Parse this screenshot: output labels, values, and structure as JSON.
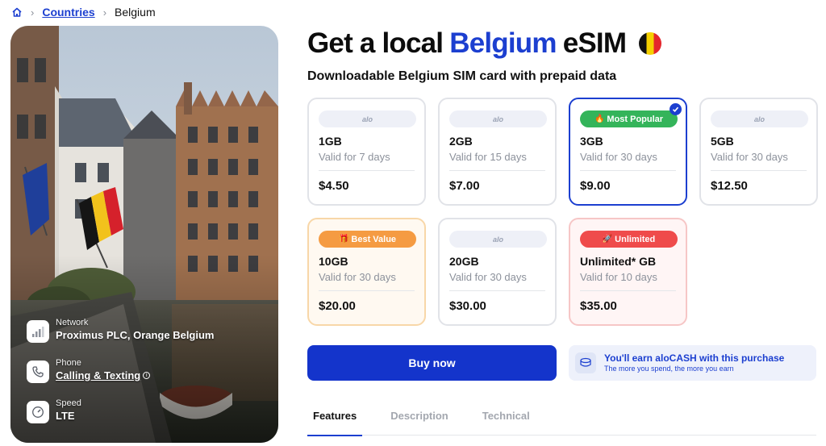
{
  "breadcrumb": {
    "home_icon": "home-icon",
    "link": "Countries",
    "current": "Belgium"
  },
  "hero": {
    "info": [
      {
        "icon": "signal-icon",
        "label": "Network",
        "value": "Proximus PLC, Orange Belgium"
      },
      {
        "icon": "phone-icon",
        "label": "Phone",
        "value": "Calling & Texting"
      },
      {
        "icon": "speedometer-icon",
        "label": "Speed",
        "value": "LTE"
      }
    ]
  },
  "title": {
    "prefix": "Get a local",
    "country": "Belgium",
    "suffix": "eSIM",
    "flag_colors": [
      "#111111",
      "#f5d000",
      "#e4262c"
    ]
  },
  "subtitle": "Downloadable Belgium SIM card with prepaid data",
  "plans": [
    {
      "badge": "alo",
      "badge_type": "brand",
      "data": "1GB",
      "validity": "Valid for 7 days",
      "price": "$4.50"
    },
    {
      "badge": "alo",
      "badge_type": "brand",
      "data": "2GB",
      "validity": "Valid for 15 days",
      "price": "$7.00"
    },
    {
      "badge": "Most Popular",
      "badge_type": "popular",
      "badge_emoji": "🔥",
      "data": "3GB",
      "validity": "Valid for 30 days",
      "price": "$9.00",
      "selected": true
    },
    {
      "badge": "alo",
      "badge_type": "brand",
      "data": "5GB",
      "validity": "Valid for 30 days",
      "price": "$12.50"
    },
    {
      "badge": "Best Value",
      "badge_type": "value",
      "badge_emoji": "🎁",
      "data": "10GB",
      "validity": "Valid for 30 days",
      "price": "$20.00"
    },
    {
      "badge": "alo",
      "badge_type": "brand",
      "data": "20GB",
      "validity": "Valid for 30 days",
      "price": "$30.00"
    },
    {
      "badge": "Unlimited",
      "badge_type": "unlimited",
      "badge_emoji": "🚀",
      "data": "Unlimited* GB",
      "validity": "Valid for 10 days",
      "price": "$35.00"
    }
  ],
  "buy_button": "Buy now",
  "cash": {
    "title": "You'll earn aloCASH with this purchase",
    "subtitle": "The more you spend, the more you earn"
  },
  "tabs": [
    "Features",
    "Description",
    "Technical"
  ],
  "colors": {
    "accent": "#1c3fd0",
    "popular": "#34b45a",
    "value": "#f59b42",
    "unlimited": "#ef4b4b"
  }
}
